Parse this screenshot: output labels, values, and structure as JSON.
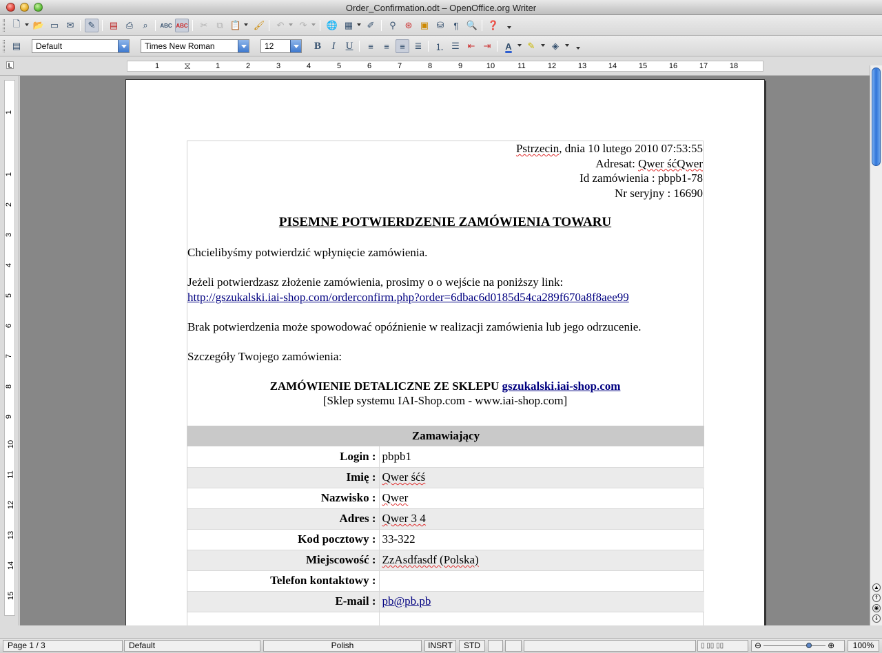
{
  "window": {
    "title": "Order_Confirmation.odt – OpenOffice.org Writer"
  },
  "toolbar1": {
    "icons": [
      "new-icon",
      "open-icon",
      "save-icon",
      "email-icon",
      "edit-file-icon",
      "export-pdf-icon",
      "print-icon",
      "page-preview-icon",
      "spellcheck-icon",
      "autospellcheck-icon",
      "cut-icon",
      "copy-icon",
      "paste-icon",
      "format-paintbrush-icon",
      "undo-icon",
      "redo-icon",
      "hyperlink-icon",
      "table-icon",
      "draw-functions-icon",
      "find-replace-icon",
      "navigator-icon",
      "gallery-icon",
      "data-sources-icon",
      "formatting-marks-icon",
      "zoom-icon",
      "help-icon"
    ]
  },
  "toolbar2": {
    "style": "Default",
    "font": "Times New Roman",
    "size": "12"
  },
  "ruler": {
    "h_labels": [
      "1",
      "1",
      "2",
      "3",
      "4",
      "5",
      "6",
      "7",
      "8",
      "9",
      "10",
      "11",
      "12",
      "13",
      "14",
      "15",
      "16",
      "17",
      "18"
    ],
    "v_labels": [
      "1",
      "1",
      "2",
      "3",
      "4",
      "5",
      "6",
      "7",
      "8",
      "9",
      "10",
      "11",
      "12",
      "13",
      "14",
      "15"
    ]
  },
  "doc": {
    "header": {
      "place": "Pstrzecin",
      "date": ", dnia 10 lutego 2010 07:53:55",
      "addressee_label": "Adresat: ",
      "addressee_name": "Qwer śćQwer",
      "order_id": "Id zamówienia : pbpb1-78",
      "serial": "Nr seryjny : 16690"
    },
    "title": "PISEMNE POTWIERDZENIE ZAMÓWIENIA TOWARU",
    "p1": "Chcielibyśmy potwierdzić wpłynięcie zamówienia.",
    "p2": "Jeżeli potwierdzasz złożenie zamówienia, prosimy o o wejście na poniższy link:",
    "link": "http://gszukalski.iai-shop.com/orderconfirm.php?order=6dbac6d0185d54ca289f670a8f8aee99",
    "p3": "Brak potwierdzenia może spowodować opóźnienie w realizacji zamówienia lub jego odrzucenie.",
    "p4": "Szczegóły Twojego zamówienia:",
    "section_heading": "ZAMÓWIENIE DETALICZNE ZE SKLEPU ",
    "shop_link": "gszukalski.iai-shop.com",
    "shop_sub": "[Sklep systemu IAI-Shop.com - www.iai-shop.com]",
    "table": {
      "header": "Zamawiający",
      "rows": [
        {
          "label": "Login :",
          "value": "pbpb1"
        },
        {
          "label": "Imię :",
          "value": "Qwer śćś"
        },
        {
          "label": "Nazwisko :",
          "value": "Qwer"
        },
        {
          "label": "Adres :",
          "value": "Qwer 3 4"
        },
        {
          "label": "Kod pocztowy :",
          "value": "33-322"
        },
        {
          "label": "Miejscowość :",
          "value": "ZzAsdfasdf (Polska)"
        },
        {
          "label": "Telefon kontaktowy :",
          "value": ""
        },
        {
          "label": "E-mail :",
          "value": "pb@pb.pb"
        }
      ]
    }
  },
  "status": {
    "page": "Page 1 / 3",
    "style": "Default",
    "language": "Polish",
    "insert": "INSRT",
    "selection": "STD",
    "zoom": "100%"
  }
}
